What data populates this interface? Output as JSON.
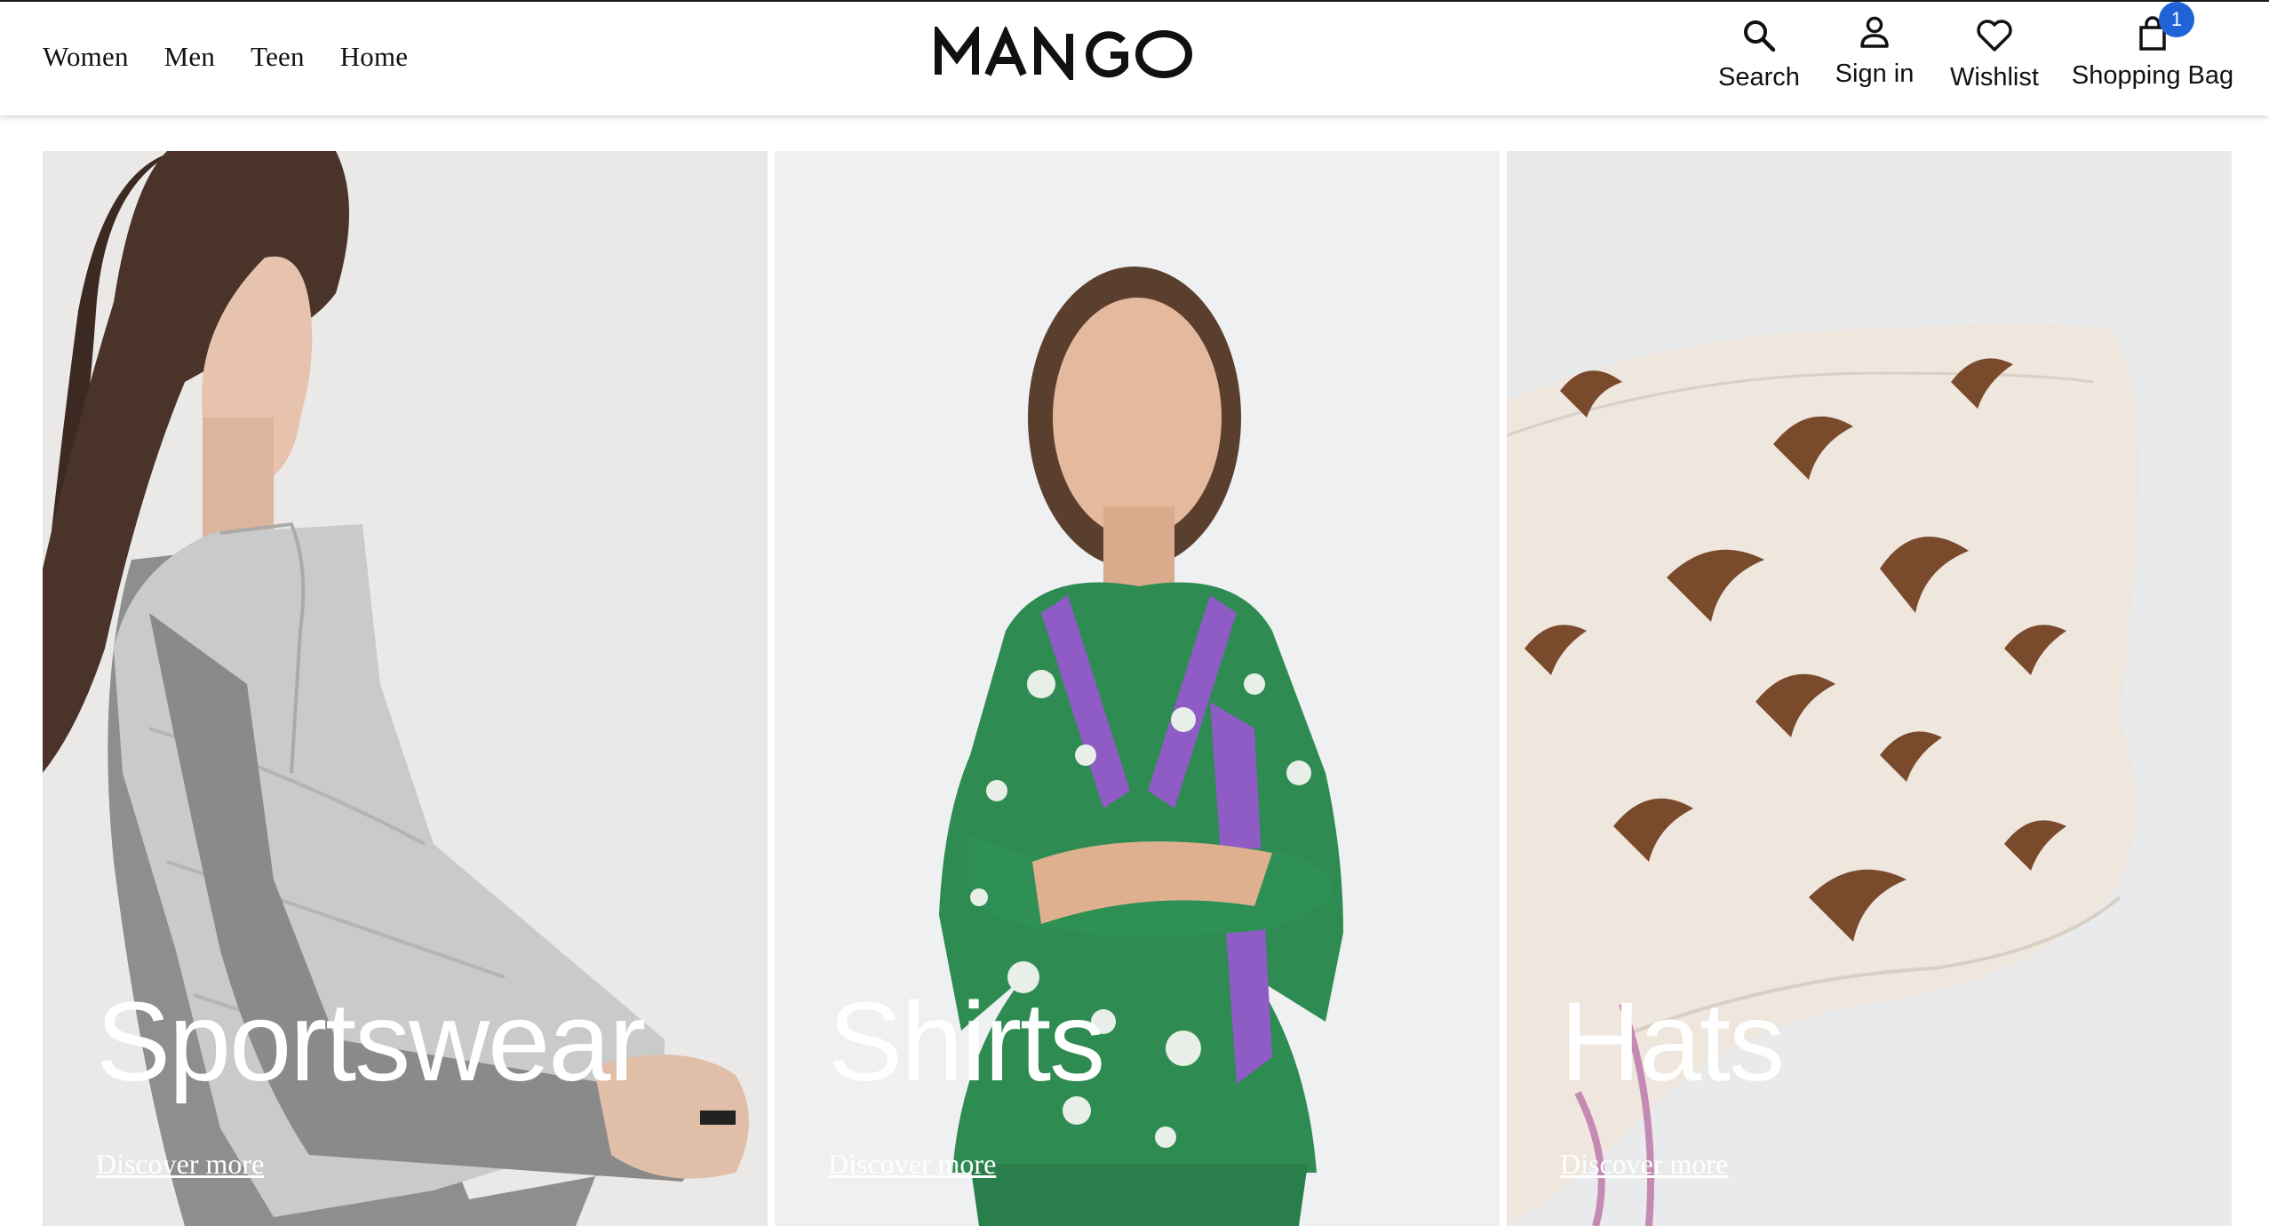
{
  "brand": {
    "name": "MANGO"
  },
  "nav": {
    "items": [
      {
        "label": "Women"
      },
      {
        "label": "Men"
      },
      {
        "label": "Teen"
      },
      {
        "label": "Home"
      }
    ]
  },
  "utilities": {
    "search": {
      "label": "Search",
      "icon": "search-icon"
    },
    "signin": {
      "label": "Sign in",
      "icon": "user-icon"
    },
    "wishlist": {
      "label": "Wishlist",
      "icon": "heart-icon"
    },
    "bag": {
      "label": "Shopping Bag",
      "icon": "shopping-bag-icon",
      "count": "1"
    }
  },
  "tiles": [
    {
      "title": "Sportswear",
      "link": "Discover more"
    },
    {
      "title": "Shirts",
      "link": "Discover more"
    },
    {
      "title": "Hats",
      "link": "Discover more"
    }
  ],
  "colors": {
    "badge": "#1f63d6",
    "text": "#111111",
    "tile_text": "#ffffff"
  }
}
